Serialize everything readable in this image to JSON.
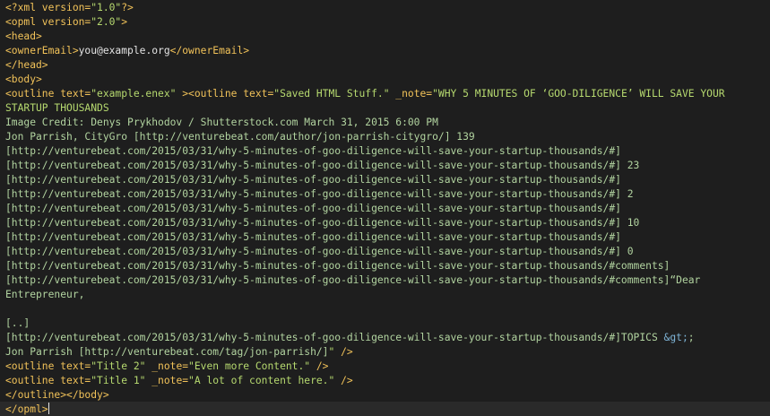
{
  "lines": [
    {
      "segments": [
        {
          "t": "<?xml version=",
          "c": "tag"
        },
        {
          "t": "\"1.0\"",
          "c": "str"
        },
        {
          "t": "?>",
          "c": "tag"
        }
      ]
    },
    {
      "segments": [
        {
          "t": "<opml version=",
          "c": "tag"
        },
        {
          "t": "\"2.0\"",
          "c": "str"
        },
        {
          "t": ">",
          "c": "tag"
        }
      ]
    },
    {
      "segments": [
        {
          "t": "<head>",
          "c": "tag"
        }
      ]
    },
    {
      "segments": [
        {
          "t": "<ownerEmail>",
          "c": "tag"
        },
        {
          "t": "you@example.org",
          "c": "text"
        },
        {
          "t": "</ownerEmail>",
          "c": "tag"
        }
      ]
    },
    {
      "segments": [
        {
          "t": "</head>",
          "c": "tag"
        }
      ]
    },
    {
      "segments": [
        {
          "t": "<body>",
          "c": "tag"
        }
      ]
    },
    {
      "segments": [
        {
          "t": "<outline text=",
          "c": "tag"
        },
        {
          "t": "\"example.enex\"",
          "c": "str"
        },
        {
          "t": " ><outline text=",
          "c": "tag"
        },
        {
          "t": "\"Saved HTML Stuff.\"",
          "c": "str"
        },
        {
          "t": " _note=",
          "c": "tag"
        },
        {
          "t": "\"WHY 5 MINUTES OF ‘GOO-DILIGENCE’ WILL SAVE YOUR",
          "c": "str"
        }
      ]
    },
    {
      "segments": [
        {
          "t": "STARTUP THOUSANDS",
          "c": "str"
        }
      ]
    },
    {
      "segments": [
        {
          "t": "Image Credit: Denys Prykhodov / Shutterstock.com March 31, 2015 6:00 PM",
          "c": "plain"
        }
      ]
    },
    {
      "segments": [
        {
          "t": "Jon Parrish, CityGro [http://venturebeat.com/author/jon-parrish-citygro/] 139",
          "c": "plain"
        }
      ]
    },
    {
      "segments": [
        {
          "t": "[http://venturebeat.com/2015/03/31/why-5-minutes-of-goo-diligence-will-save-your-startup-thousands/#]",
          "c": "plain"
        }
      ]
    },
    {
      "segments": [
        {
          "t": "[http://venturebeat.com/2015/03/31/why-5-minutes-of-goo-diligence-will-save-your-startup-thousands/#] 23",
          "c": "plain"
        }
      ]
    },
    {
      "segments": [
        {
          "t": "[http://venturebeat.com/2015/03/31/why-5-minutes-of-goo-diligence-will-save-your-startup-thousands/#]",
          "c": "plain"
        }
      ]
    },
    {
      "segments": [
        {
          "t": "[http://venturebeat.com/2015/03/31/why-5-minutes-of-goo-diligence-will-save-your-startup-thousands/#] 2",
          "c": "plain"
        }
      ]
    },
    {
      "segments": [
        {
          "t": "[http://venturebeat.com/2015/03/31/why-5-minutes-of-goo-diligence-will-save-your-startup-thousands/#]",
          "c": "plain"
        }
      ]
    },
    {
      "segments": [
        {
          "t": "[http://venturebeat.com/2015/03/31/why-5-minutes-of-goo-diligence-will-save-your-startup-thousands/#] 10",
          "c": "plain"
        }
      ]
    },
    {
      "segments": [
        {
          "t": "[http://venturebeat.com/2015/03/31/why-5-minutes-of-goo-diligence-will-save-your-startup-thousands/#]",
          "c": "plain"
        }
      ]
    },
    {
      "segments": [
        {
          "t": "[http://venturebeat.com/2015/03/31/why-5-minutes-of-goo-diligence-will-save-your-startup-thousands/#] 0",
          "c": "plain"
        }
      ]
    },
    {
      "segments": [
        {
          "t": "[http://venturebeat.com/2015/03/31/why-5-minutes-of-goo-diligence-will-save-your-startup-thousands/#comments]",
          "c": "plain"
        }
      ]
    },
    {
      "segments": [
        {
          "t": "[http://venturebeat.com/2015/03/31/why-5-minutes-of-goo-diligence-will-save-your-startup-thousands/#comments]“Dear",
          "c": "plain"
        }
      ]
    },
    {
      "segments": [
        {
          "t": "Entrepreneur,",
          "c": "plain"
        }
      ]
    },
    {
      "segments": [
        {
          "t": "",
          "c": "plain"
        }
      ]
    },
    {
      "segments": [
        {
          "t": "[..]",
          "c": "plain"
        }
      ]
    },
    {
      "segments": [
        {
          "t": "[http://venturebeat.com/2015/03/31/why-5-minutes-of-goo-diligence-will-save-your-startup-thousands/#]TOPICS ",
          "c": "plain"
        },
        {
          "t": "&gt;",
          "c": "entity"
        },
        {
          "t": ";",
          "c": "plain"
        }
      ]
    },
    {
      "segments": [
        {
          "t": "Jon Parrish [http://venturebeat.com/tag/jon-parrish/]",
          "c": "plain"
        },
        {
          "t": "\"",
          "c": "str"
        },
        {
          "t": " />",
          "c": "tag"
        }
      ]
    },
    {
      "segments": [
        {
          "t": "<outline text=",
          "c": "tag"
        },
        {
          "t": "\"Title 2\"",
          "c": "str"
        },
        {
          "t": " _note=",
          "c": "tag"
        },
        {
          "t": "\"Even more Content.\"",
          "c": "str"
        },
        {
          "t": " />",
          "c": "tag"
        }
      ]
    },
    {
      "segments": [
        {
          "t": "<outline text=",
          "c": "tag"
        },
        {
          "t": "\"Title 1\"",
          "c": "str"
        },
        {
          "t": " _note=",
          "c": "tag"
        },
        {
          "t": "\"A lot of content here.\"",
          "c": "str"
        },
        {
          "t": " />",
          "c": "tag"
        }
      ]
    },
    {
      "segments": [
        {
          "t": "</outline></body>",
          "c": "tag"
        }
      ]
    },
    {
      "segments": [
        {
          "t": "</opml>",
          "c": "tag"
        }
      ],
      "cursor": true
    }
  ]
}
